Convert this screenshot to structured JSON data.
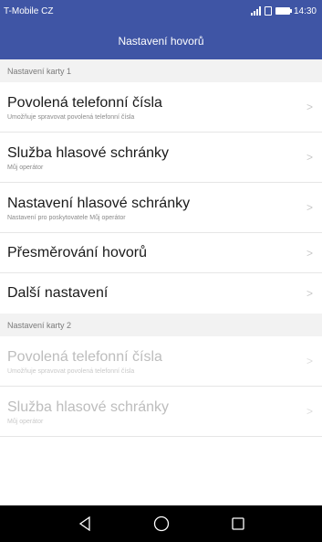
{
  "status_bar": {
    "carrier": "T-Mobile CZ",
    "time": "14:30",
    "icons": [
      "signal-icon",
      "sim-icon",
      "battery-icon"
    ]
  },
  "header": {
    "title": "Nastavení hovorů"
  },
  "sections": [
    {
      "header": "Nastavení karty 1",
      "items": [
        {
          "title": "Povolená telefonní čísla",
          "subtitle": "Umožňuje spravovat povolená telefonní čísla"
        },
        {
          "title": "Služba hlasové schránky",
          "subtitle": "Můj operátor"
        },
        {
          "title": "Nastavení hlasové schránky",
          "subtitle": "Nastavení pro poskytovatele Můj operátor"
        },
        {
          "title": "Přesměrování hovorů"
        },
        {
          "title": "Další nastavení"
        }
      ]
    },
    {
      "header": "Nastavení karty 2",
      "items": [
        {
          "title": "Povolená telefonní čísla",
          "subtitle": "Umožňuje spravovat povolená telefonní čísla"
        },
        {
          "title": "Služba hlasové schránky",
          "subtitle": "Můj operátor"
        }
      ]
    }
  ],
  "colors": {
    "accent": "#3f55a5",
    "section_bg": "#f2f2f2",
    "disabled_text": "#bdbdbd"
  },
  "nav_bar": {
    "icons": [
      "back-icon",
      "home-icon",
      "recents-icon"
    ]
  }
}
